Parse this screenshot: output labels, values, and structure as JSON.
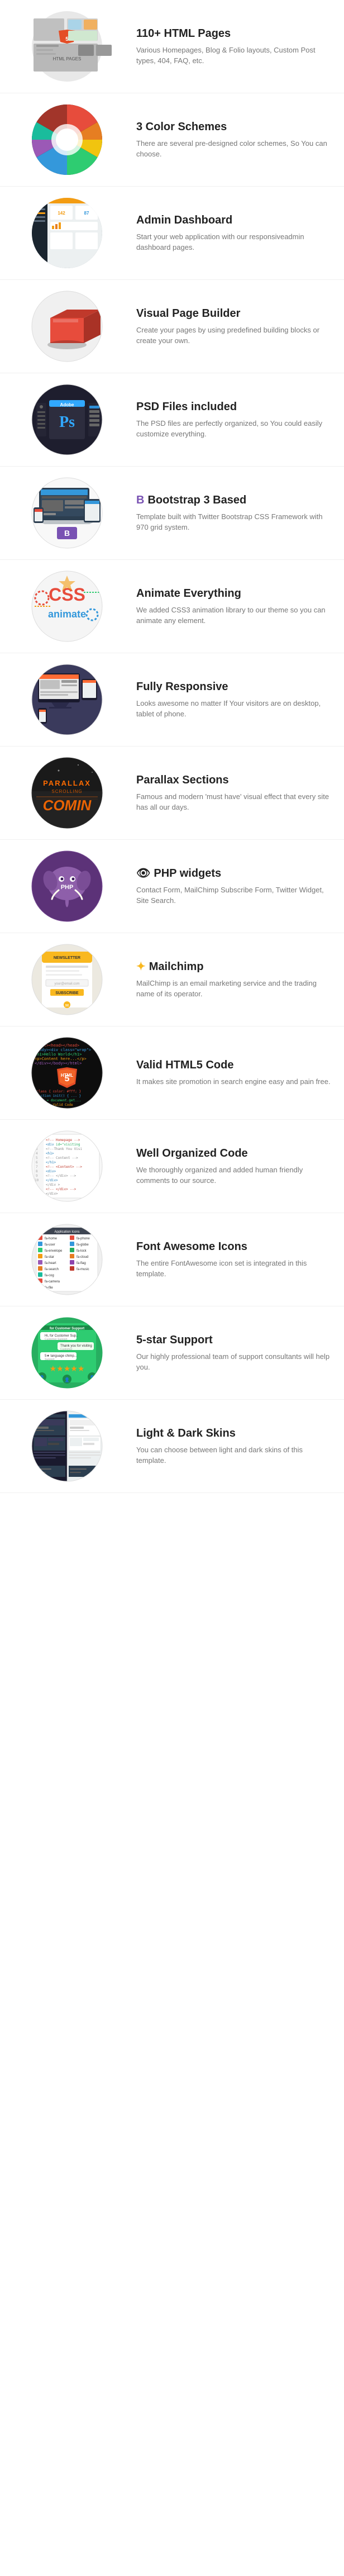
{
  "features": [
    {
      "id": "html-pages",
      "title": "110+ HTML Pages",
      "desc": "Various Homepages, Blog & Folio layouts, Custom Post types, 404, FAQ, etc.",
      "image_type": "html5",
      "image_label": "HTML5"
    },
    {
      "id": "color-schemes",
      "title": "3 Color Schemes",
      "desc": "There are several pre-designed color schemes, So You can choose.",
      "image_type": "colors",
      "image_label": "Colors"
    },
    {
      "id": "admin-dashboard",
      "title": "Admin Dashboard",
      "desc": "Start your web application with our responsiveadmin dashboard pages.",
      "image_type": "admin",
      "image_label": "Admin"
    },
    {
      "id": "visual-builder",
      "title": "Visual Page Builder",
      "desc": "Create your pages by using predefined building blocks or create your own.",
      "image_type": "builder",
      "image_label": "Builder"
    },
    {
      "id": "psd-files",
      "title": "PSD Files included",
      "desc": "The PSD files are perfectly organized, so You could easily customize everything.",
      "image_type": "psd",
      "image_label": "Photoshop"
    },
    {
      "id": "bootstrap",
      "title": "Bootstrap 3 Based",
      "desc": "Template built with Twitter Bootstrap CSS Framework with 970 grid system.",
      "image_type": "bootstrap",
      "image_label": "Bootstrap"
    },
    {
      "id": "animate",
      "title": "Animate Everything",
      "desc": "We added CSS3 animation library to our theme so you can animate any element.",
      "image_type": "css",
      "image_label": "CSS"
    },
    {
      "id": "responsive",
      "title": "Fully Responsive",
      "desc": "Looks awesome no matter If Your visitors are on desktop, tablet of phone.",
      "image_type": "responsive",
      "image_label": "Responsive"
    },
    {
      "id": "parallax",
      "title": "Parallax Sections",
      "desc": "Famous and modern 'must have' visual effect that every site has all our days.",
      "image_type": "parallax",
      "image_label": "Parallax"
    },
    {
      "id": "php-widgets",
      "title": "PHP widgets",
      "desc": "Contact Form, MailChimp Subscribe Form, Twitter Widget, Site Search.",
      "image_type": "php",
      "image_label": "PHP"
    },
    {
      "id": "mailchimp",
      "title": "Mailchimp",
      "desc": "MailChimp is an email marketing service and the trading name of its operator.",
      "image_type": "mailchimp",
      "image_label": "Mailchimp"
    },
    {
      "id": "html5-valid",
      "title": "Valid HTML5 Code",
      "desc": "It makes site promotion in search engine easy and pain free.",
      "image_type": "html5code",
      "image_label": "HTML5"
    },
    {
      "id": "organized-code",
      "title": "Well Organized Code",
      "desc": "We thoroughly organized and added human friendly comments to our source.",
      "image_type": "code",
      "image_label": "Code"
    },
    {
      "id": "font-awesome",
      "title": "Font Awesome Icons",
      "desc": "The entire FontAwesome icon set is integrated in this template.",
      "image_type": "fontawesome",
      "image_label": "FontAwesome"
    },
    {
      "id": "support",
      "title": "5-star Support",
      "desc": "Our highly professional team of support consultants will help you.",
      "image_type": "support",
      "image_label": "Support"
    },
    {
      "id": "skins",
      "title": "Light & Dark Skins",
      "desc": "You can choose between light and dark skins of this template.",
      "image_type": "skins",
      "image_label": "Skins"
    }
  ],
  "comin_text": "COMIN",
  "accent_color": "#ff6600",
  "bootstrap_icon": "B",
  "eye_icon": "👁"
}
